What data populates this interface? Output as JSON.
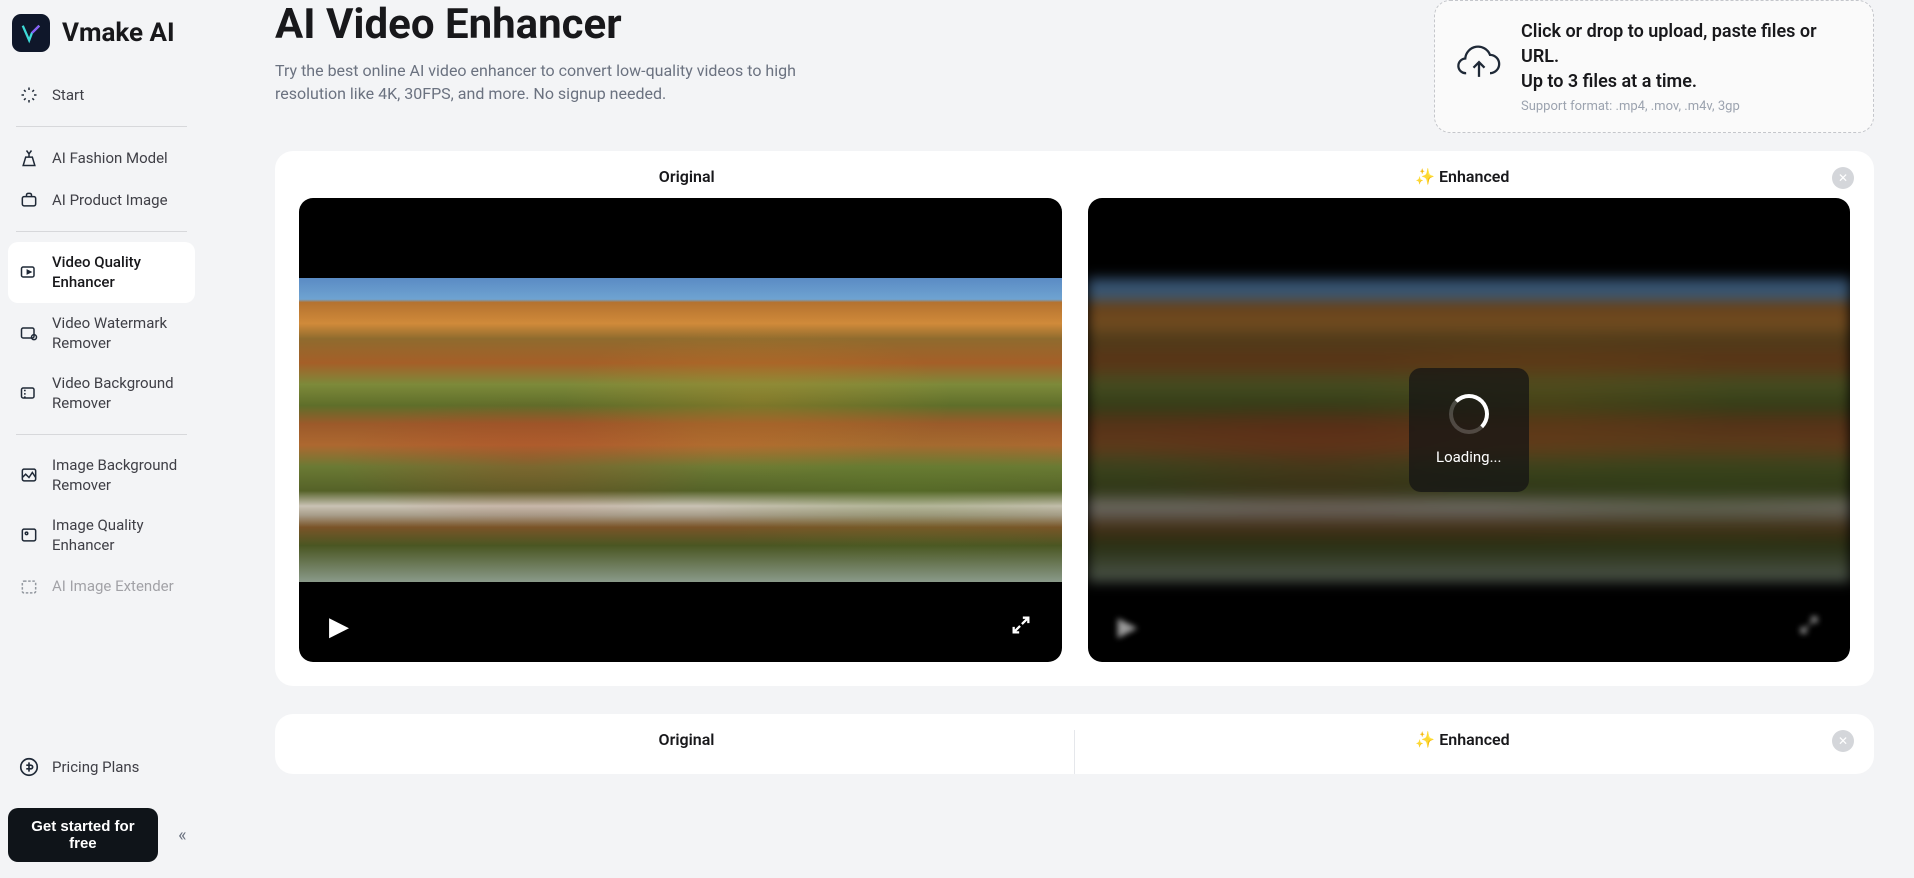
{
  "brand": {
    "name": "Vmake AI"
  },
  "sidebar": {
    "items": [
      {
        "label": "Start"
      },
      {
        "label": "AI Fashion Model"
      },
      {
        "label": "AI Product Image"
      },
      {
        "label": "Video Quality Enhancer"
      },
      {
        "label": "Video Watermark Remover"
      },
      {
        "label": "Video Background Remover"
      },
      {
        "label": "Image Background Remover"
      },
      {
        "label": "Image Quality Enhancer"
      },
      {
        "label": "AI Image Extender"
      }
    ],
    "pricing": "Pricing Plans",
    "cta": "Get started for free"
  },
  "page": {
    "title": "AI Video Enhancer",
    "subtitle": "Try the best online AI video enhancer to convert low-quality videos to high resolution like 4K, 30FPS, and more. No signup needed."
  },
  "upload": {
    "line1": "Click or drop to upload, paste files or URL.",
    "line2": "Up to 3 files at a time.",
    "formats": "Support format: .mp4, .mov, .m4v, 3gp"
  },
  "preview": {
    "original_label": "Original",
    "enhanced_label": "Enhanced",
    "loading": "Loading..."
  },
  "second_preview": {
    "original_label": "Original",
    "enhanced_label": "Enhanced"
  }
}
